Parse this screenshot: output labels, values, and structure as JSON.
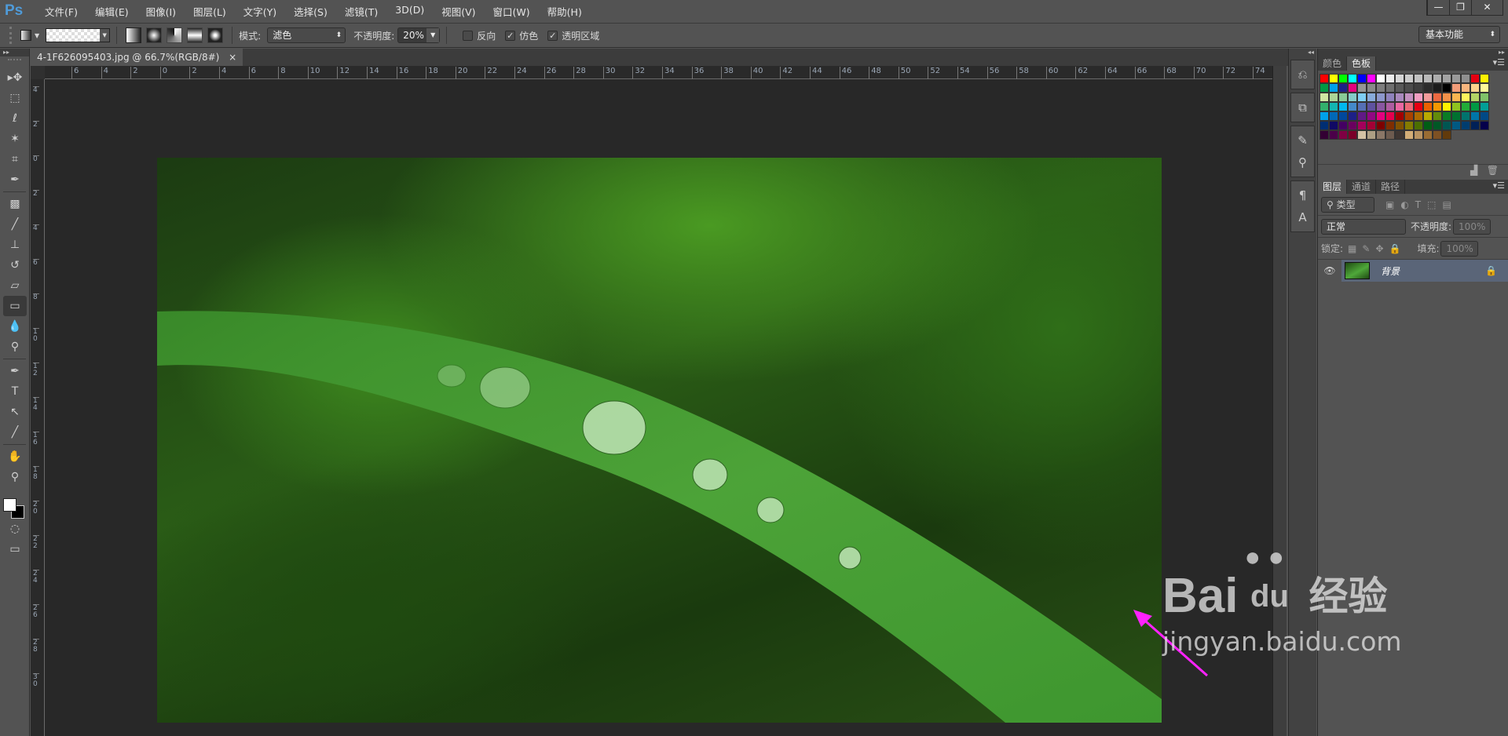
{
  "app": {
    "logo": "Ps"
  },
  "menu": [
    "文件(F)",
    "编辑(E)",
    "图像(I)",
    "图层(L)",
    "文字(Y)",
    "选择(S)",
    "滤镜(T)",
    "3D(D)",
    "视图(V)",
    "窗口(W)",
    "帮助(H)"
  ],
  "window": {
    "minimize": "—",
    "restore": "❐",
    "close": "✕"
  },
  "options": {
    "mode_label": "模式:",
    "mode_value": "滤色",
    "opacity_label": "不透明度:",
    "opacity_value": "20%",
    "reverse_label": "反向",
    "reverse_checked": false,
    "dither_label": "仿色",
    "dither_checked": true,
    "transparency_label": "透明区域",
    "transparency_checked": true
  },
  "workspace": "基本功能",
  "document": {
    "tab_title": "4-1F626095403.jpg @ 66.7%(RGB/8#)",
    "close": "×"
  },
  "rulers": {
    "horizontal": [
      "6",
      "4",
      "2",
      "0",
      "2",
      "4",
      "6",
      "8",
      "10",
      "12",
      "14",
      "16",
      "18",
      "20",
      "22",
      "24",
      "26",
      "28",
      "30",
      "32",
      "34",
      "36",
      "38",
      "40",
      "42",
      "44",
      "46",
      "48",
      "50",
      "52",
      "54",
      "56",
      "58",
      "60",
      "62",
      "64",
      "66",
      "68",
      "70",
      "72",
      "74"
    ],
    "vertical": [
      "4",
      "2",
      "0",
      "2",
      "4",
      "6",
      "8",
      "10",
      "12",
      "14",
      "16",
      "18",
      "20",
      "22",
      "24",
      "26",
      "28",
      "30"
    ]
  },
  "tools": [
    "move",
    "marquee",
    "lasso",
    "magic-wand",
    "crop",
    "eyedropper",
    "healing-brush",
    "brush",
    "clone-stamp",
    "history-brush",
    "eraser",
    "gradient",
    "blur",
    "dodge",
    "pen",
    "type",
    "path-selection",
    "line",
    "hand",
    "zoom"
  ],
  "swatch_panel": {
    "tabs": [
      "颜色",
      "色板"
    ],
    "active": 1,
    "colors": [
      "#ff0000",
      "#ffff00",
      "#00ff00",
      "#00ffff",
      "#0000ff",
      "#ff00ff",
      "#ffffff",
      "#ebebeb",
      "#d6d6d6",
      "#cccccc",
      "#c2c2c2",
      "#b8b8b8",
      "#adadad",
      "#a3a3a3",
      "#999999",
      "#8f8f8f",
      "#e60012",
      "#fff100",
      "#009944",
      "#00a0e9",
      "#1d2088",
      "#e4007f",
      "#959595",
      "#898989",
      "#7d7d7d",
      "#6f6f6f",
      "#595959",
      "#4c4c4c",
      "#3e3e3e",
      "#2b2b2b",
      "#1c1c1c",
      "#000000",
      "#f19c79",
      "#f8b57e",
      "#fcd38e",
      "#fff799",
      "#cfe5a2",
      "#acd598",
      "#89c997",
      "#84ccc9",
      "#7ecef4",
      "#88abda",
      "#8c97cb",
      "#8f82bc",
      "#aa89bd",
      "#c490bf",
      "#f29ec2",
      "#f29b9b",
      "#ec6941",
      "#f19149",
      "#f8b551",
      "#fff45c",
      "#b3d465",
      "#80c269",
      "#32b16c",
      "#13b5b1",
      "#00b7ee",
      "#448aca",
      "#556fb5",
      "#5f52a0",
      "#8957a1",
      "#ae5da1",
      "#ea68a2",
      "#eb6877",
      "#e60012",
      "#eb6100",
      "#f39800",
      "#fff100",
      "#8fc31f",
      "#22ac38",
      "#009944",
      "#009e96",
      "#00a0e9",
      "#0068b7",
      "#00479d",
      "#1d2088",
      "#601986",
      "#920783",
      "#e4007f",
      "#e5004f",
      "#a40000",
      "#a84200",
      "#ac6a00",
      "#b7aa00",
      "#638c0b",
      "#097c25",
      "#007130",
      "#00736d",
      "#0075a9",
      "#004986",
      "#002e73",
      "#100964",
      "#440062",
      "#6a005f",
      "#a4005b",
      "#a40035",
      "#7d0000",
      "#7f2e00",
      "#815200",
      "#847c00",
      "#4c6f00",
      "#005e15",
      "#005826",
      "#005652",
      "#005982",
      "#003d6f",
      "#002157",
      "#05004b",
      "#330033",
      "#4b0049",
      "#7e0043",
      "#7a0029",
      "#d3c2a4",
      "#ad9f84",
      "#8a7767",
      "#6d5b4f",
      "#3f3632",
      "#d2ad77",
      "#b89362",
      "#996c33",
      "#7e5123",
      "#623a0b"
    ]
  },
  "layers_panel": {
    "tabs": [
      "图层",
      "通道",
      "路径"
    ],
    "active": 0,
    "filter": "类型",
    "blend_mode": "正常",
    "opacity_label": "不透明度:",
    "opacity_value": "100%",
    "lock_label": "锁定:",
    "fill_label": "填充:",
    "fill_value": "100%",
    "layers": [
      {
        "name": "背景",
        "visible": true,
        "locked": true
      }
    ]
  },
  "watermark": {
    "brand": "Bai",
    "brand2": "du",
    "brand_cn": "经验",
    "url": "jingyan.baidu.com"
  },
  "colors": {
    "accent_arrow": "#ff22ff",
    "layer_selected": "#5a6578"
  }
}
